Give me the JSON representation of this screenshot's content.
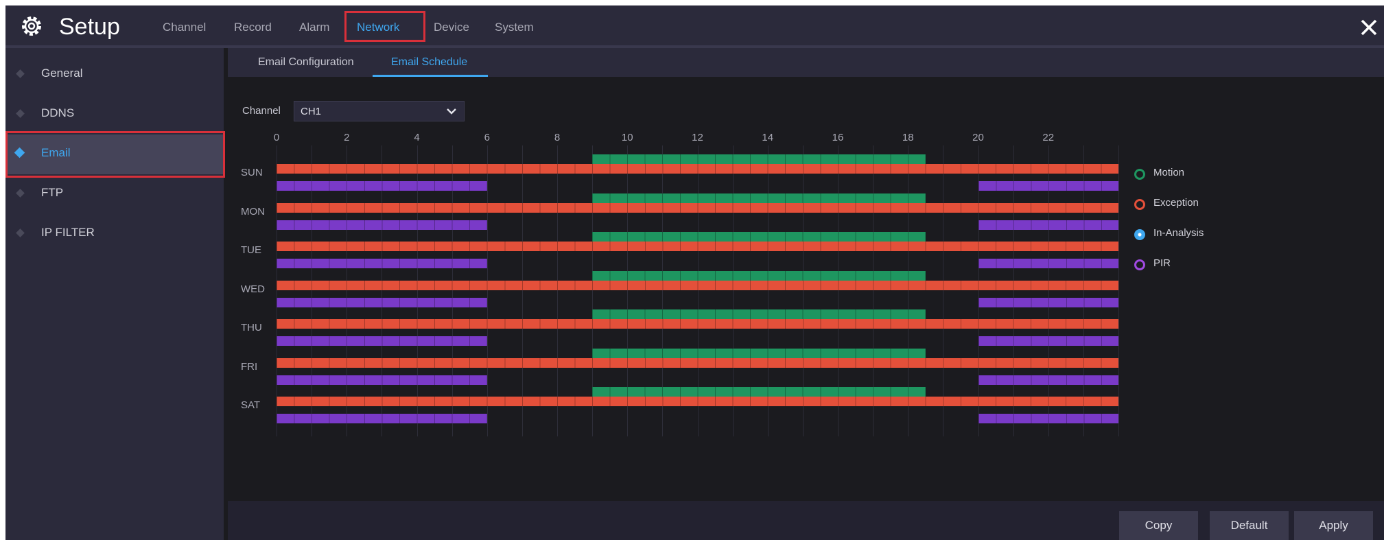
{
  "app": {
    "title": "Setup",
    "logo_icon": "gear-icon",
    "close_icon": "close-icon"
  },
  "menu": {
    "tabs": [
      {
        "label": "Channel"
      },
      {
        "label": "Record"
      },
      {
        "label": "Alarm"
      },
      {
        "label": "Network",
        "active": true
      },
      {
        "label": "Device"
      },
      {
        "label": "System"
      }
    ]
  },
  "sidebar": {
    "items": [
      {
        "label": "General"
      },
      {
        "label": "DDNS"
      },
      {
        "label": "Email",
        "active": true
      },
      {
        "label": "FTP"
      },
      {
        "label": "IP FILTER"
      }
    ]
  },
  "subtabs": [
    {
      "label": "Email Configuration"
    },
    {
      "label": "Email Schedule",
      "active": true
    }
  ],
  "channel": {
    "label": "Channel",
    "value": "CH1"
  },
  "schedule": {
    "hours": [
      "0",
      "2",
      "4",
      "6",
      "8",
      "10",
      "12",
      "14",
      "16",
      "18",
      "20",
      "22"
    ],
    "days": [
      "SUN",
      "MON",
      "TUE",
      "WED",
      "THU",
      "FRI",
      "SAT"
    ],
    "colors": {
      "motion": "#1e9660",
      "exception": "#e4503a",
      "pir": "#7a3ac8"
    },
    "bars": {
      "motion": [
        [
          9,
          18.5
        ]
      ],
      "exception": [
        [
          0,
          24
        ]
      ],
      "pir": [
        [
          0,
          6
        ],
        [
          20,
          24
        ]
      ]
    }
  },
  "legend": [
    {
      "label": "Motion",
      "color": "#1e9660",
      "filled": false
    },
    {
      "label": "Exception",
      "color": "#e4503a",
      "filled": false
    },
    {
      "label": "In-Analysis",
      "color": "#3fa7ef",
      "filled": true
    },
    {
      "label": "PIR",
      "color": "#a04ae0",
      "filled": false
    }
  ],
  "buttons": {
    "copy": "Copy",
    "default": "Default",
    "apply": "Apply"
  }
}
